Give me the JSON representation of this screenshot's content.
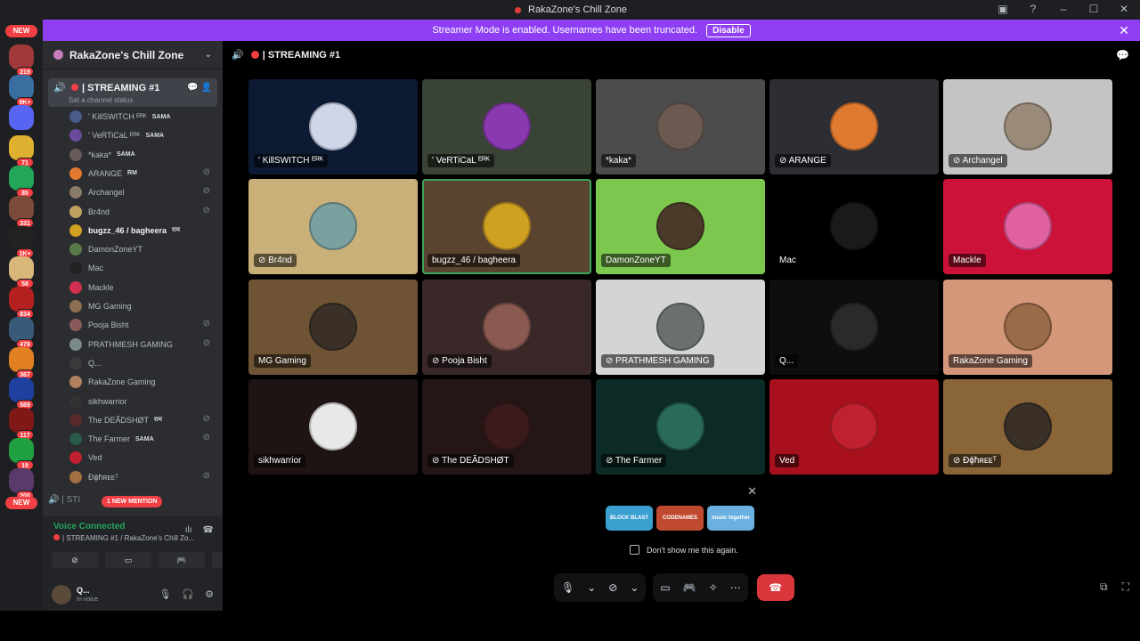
{
  "window": {
    "title": "RakaZone's Chill Zone",
    "controls": [
      "screen-icon",
      "help-icon",
      "minimize-icon",
      "maximize-icon",
      "close-icon"
    ]
  },
  "banner": {
    "text": "Streamer Mode is enabled. Usernames have been truncated.",
    "button": "Disable",
    "color": "#8e3ff4"
  },
  "rail": {
    "new_top": "NEW",
    "new_bottom": "NEW",
    "servers": [
      {
        "count": "219",
        "color": "#a03a3a"
      },
      {
        "count": "9K+",
        "color": "#3a6ea0"
      },
      {
        "count": "",
        "color": "#5865f2"
      },
      {
        "count": "71",
        "color": "#e0b030"
      },
      {
        "count": "85",
        "color": "#23a55a"
      },
      {
        "count": "331",
        "color": "#7a4a3a"
      },
      {
        "count": "1K+",
        "color": "#222"
      },
      {
        "count": "58",
        "color": "#d9b77a"
      },
      {
        "count": "834",
        "color": "#b32020"
      },
      {
        "count": "478",
        "color": "#3a5a7a"
      },
      {
        "count": "367",
        "color": "#e08020"
      },
      {
        "count": "589",
        "color": "#2040a0"
      },
      {
        "count": "117",
        "color": "#801818"
      },
      {
        "count": "19",
        "color": "#20a040"
      },
      {
        "count": "200",
        "color": "#5a3a6a"
      }
    ]
  },
  "sidebar": {
    "server_name": "RakaZone's Chill Zone",
    "current_channel": {
      "name": "| STREAMING #1",
      "status": "Set a channel status"
    },
    "members": [
      {
        "name": "' KillSWITCH ᴱᴿᴷ",
        "tag": "SAMA",
        "deafened": false,
        "color": "#4a5a8a"
      },
      {
        "name": "' VeRTiCaL ᴱᴿᴷ",
        "tag": "SAMA",
        "deafened": false,
        "color": "#6a4a9a"
      },
      {
        "name": "*kaka*",
        "tag": "SAMA",
        "deafened": false,
        "color": "#6a5a5a"
      },
      {
        "name": "ARANGE",
        "tag": "RM",
        "deafened": true,
        "color": "#e07a30"
      },
      {
        "name": "Archangel",
        "tag": "",
        "deafened": true,
        "color": "#8a7a6a"
      },
      {
        "name": "Br4nd",
        "tag": "",
        "deafened": true,
        "color": "#c0a060"
      },
      {
        "name": "bugzz_46 / bagheera",
        "tag": "राम",
        "deafened": false,
        "color": "#d0a020",
        "bold": true
      },
      {
        "name": "DamonZoneYT",
        "tag": "",
        "deafened": false,
        "color": "#5a7a4a"
      },
      {
        "name": "Mac",
        "tag": "",
        "deafened": false,
        "color": "#222"
      },
      {
        "name": "Mackle",
        "tag": "",
        "deafened": false,
        "color": "#d03050"
      },
      {
        "name": "MG Gaming",
        "tag": "",
        "deafened": false,
        "color": "#8a7050"
      },
      {
        "name": "Pooja Bisht",
        "tag": "",
        "deafened": true,
        "color": "#8a5a5a"
      },
      {
        "name": "PRATHMESH GAMING",
        "tag": "",
        "deafened": true,
        "color": "#7a8a8a"
      },
      {
        "name": "Q...",
        "tag": "",
        "deafened": false,
        "color": "#3a3a3a"
      },
      {
        "name": "RakaZone Gaming",
        "tag": "",
        "deafened": false,
        "color": "#b08060"
      },
      {
        "name": "sikhwarrior",
        "tag": "",
        "deafened": false,
        "color": "#333"
      },
      {
        "name": "The DEÃDSHØT",
        "tag": "राम",
        "deafened": true,
        "color": "#5a2a2a"
      },
      {
        "name": "The Farmer",
        "tag": "SAMA",
        "deafened": true,
        "color": "#2a5a4a"
      },
      {
        "name": "Ved",
        "tag": "",
        "deafened": false,
        "color": "#c02030"
      },
      {
        "name": "Đɸħʀᴇᴇᵀ",
        "tag": "",
        "deafened": true,
        "color": "#a07040"
      }
    ],
    "next_channel": "| STI",
    "mention_badge": "1 NEW MENTION"
  },
  "voice": {
    "status": "Voice Connected",
    "channel": "| STREAMING #1 / RakaZone's Chill Zo...",
    "user_name": "Q...",
    "user_status": "In voice"
  },
  "main": {
    "channel_title": "| STREAMING #1",
    "tiles": [
      {
        "name": "' KillSWITCH ᴱᴿᴷ",
        "bg": "#0d1a33",
        "av": "#cfd6e8",
        "deaf": false
      },
      {
        "name": "' VeRTiCaL ᴱᴿᴷ",
        "bg": "#3a4436",
        "av": "#8a3ab0",
        "deaf": false
      },
      {
        "name": "*kaka*",
        "bg": "#4c4c4c",
        "av": "#6a5a50",
        "deaf": false
      },
      {
        "name": "ARANGE",
        "bg": "#2c2e33",
        "av": "#e07a30",
        "deaf": true
      },
      {
        "name": "Archangel",
        "bg": "#c4c4c4",
        "av": "#9a8a7a",
        "deaf": true
      },
      {
        "name": "Br4nd",
        "bg": "#c8b078",
        "av": "#7aa0a0",
        "deaf": true
      },
      {
        "name": "bugzz_46 / bagheera",
        "bg": "#5a4430",
        "av": "#d0a020",
        "deaf": false,
        "speaking": true
      },
      {
        "name": "DamonZoneYT",
        "bg": "#7cc84e",
        "av": "#4a3a2a",
        "deaf": false
      },
      {
        "name": "Mac",
        "bg": "#000000",
        "av": "#1a1a1a",
        "deaf": false
      },
      {
        "name": "Mackle",
        "bg": "#cc1238",
        "av": "#e060a0",
        "deaf": false
      },
      {
        "name": "MG Gaming",
        "bg": "#6e5434",
        "av": "#3a3028",
        "deaf": false
      },
      {
        "name": "Pooja Bisht",
        "bg": "#3a2828",
        "av": "#8a5a50",
        "deaf": true
      },
      {
        "name": "PRATHMESH GAMING",
        "bg": "#d4d4d4",
        "av": "#6a7070",
        "deaf": true
      },
      {
        "name": "Q...",
        "bg": "#0e0e0e",
        "av": "#2a2a2a",
        "deaf": false
      },
      {
        "name": "RakaZone Gaming",
        "bg": "#d4977a",
        "av": "#9a6a4a",
        "deaf": false
      },
      {
        "name": "sikhwarrior",
        "bg": "#1e1414",
        "av": "#e8e8e8",
        "deaf": false
      },
      {
        "name": "The DEÃDSHØT",
        "bg": "#241616",
        "av": "#3a1a1a",
        "deaf": true
      },
      {
        "name": "The Farmer",
        "bg": "#0c2a26",
        "av": "#2a6a5a",
        "deaf": true
      },
      {
        "name": "Ved",
        "bg": "#a8101e",
        "av": "#c02030",
        "deaf": false
      },
      {
        "name": "Đɸħʀᴇᴇᵀ",
        "bg": "#8a6538",
        "av": "#3a3028",
        "deaf": true
      }
    ],
    "promo": {
      "activities": [
        {
          "label": "BLOCK BLAST",
          "color": "#3aa0d0"
        },
        {
          "label": "CODENAMES",
          "color": "#c04a30"
        },
        {
          "label": "music together",
          "color": "#6ab0e0"
        }
      ],
      "dont_show": "Don't show me this again."
    }
  }
}
